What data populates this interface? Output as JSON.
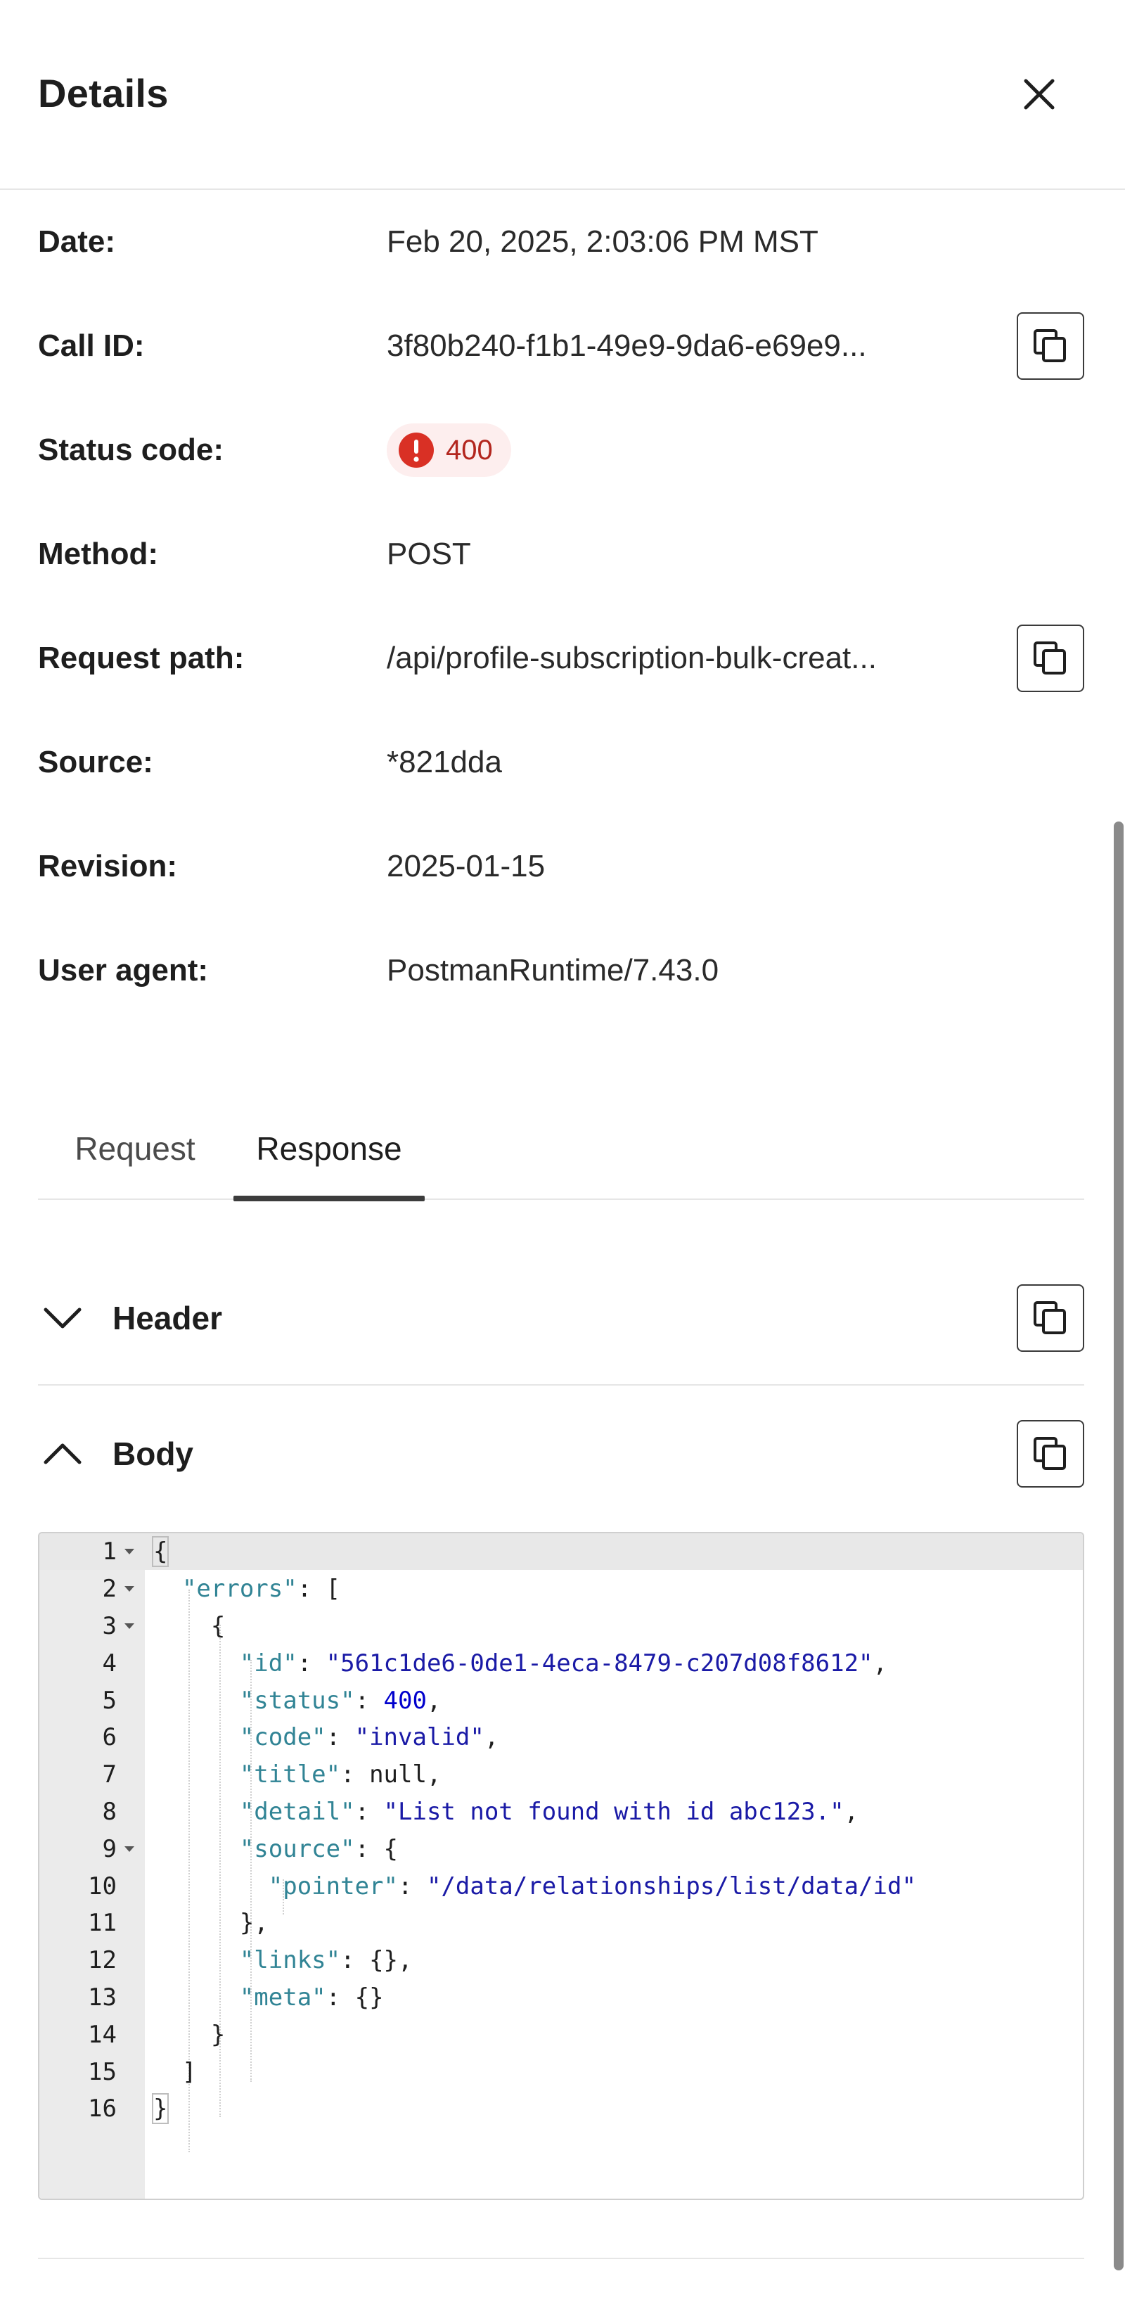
{
  "panel": {
    "title": "Details"
  },
  "details": [
    {
      "label": "Date:",
      "value": "Feb 20, 2025, 2:03:06 PM MST",
      "copyable": false
    },
    {
      "label": "Call ID:",
      "value": "3f80b240-f1b1-49e9-9da6-e69e9...",
      "copyable": true
    },
    {
      "label": "Status code:",
      "value": "400",
      "badge": true
    },
    {
      "label": "Method:",
      "value": "POST",
      "copyable": false
    },
    {
      "label": "Request path:",
      "value": "/api/profile-subscription-bulk-creat...",
      "copyable": true
    },
    {
      "label": "Source:",
      "value": "*821dda",
      "copyable": false
    },
    {
      "label": "Revision:",
      "value": "2025-01-15",
      "copyable": false
    },
    {
      "label": "User agent:",
      "value": "PostmanRuntime/7.43.0",
      "copyable": false
    }
  ],
  "tabs": [
    {
      "label": "Request",
      "active": false
    },
    {
      "label": "Response",
      "active": true
    }
  ],
  "sections": {
    "header": {
      "label": "Header",
      "expanded": false
    },
    "body": {
      "label": "Body",
      "expanded": true
    }
  },
  "code_lines": [
    {
      "n": "1",
      "fold": true,
      "text": "{"
    },
    {
      "n": "2",
      "fold": true,
      "text": "  \"errors\": ["
    },
    {
      "n": "3",
      "fold": true,
      "text": "    {"
    },
    {
      "n": "4",
      "fold": false,
      "text": "      \"id\": \"561c1de6-0de1-4eca-8479-c207d08f8612\","
    },
    {
      "n": "5",
      "fold": false,
      "text": "      \"status\": 400,"
    },
    {
      "n": "6",
      "fold": false,
      "text": "      \"code\": \"invalid\","
    },
    {
      "n": "7",
      "fold": false,
      "text": "      \"title\": null,"
    },
    {
      "n": "8",
      "fold": false,
      "text": "      \"detail\": \"List not found with id abc123.\","
    },
    {
      "n": "9",
      "fold": true,
      "text": "      \"source\": {"
    },
    {
      "n": "10",
      "fold": false,
      "text": "        \"pointer\": \"/data/relationships/list/data/id\""
    },
    {
      "n": "11",
      "fold": false,
      "text": "      },"
    },
    {
      "n": "12",
      "fold": false,
      "text": "      \"links\": {},"
    },
    {
      "n": "13",
      "fold": false,
      "text": "      \"meta\": {}"
    },
    {
      "n": "14",
      "fold": false,
      "text": "    }"
    },
    {
      "n": "15",
      "fold": false,
      "text": "  ]"
    },
    {
      "n": "16",
      "fold": false,
      "text": "}"
    }
  ],
  "colors": {
    "error_badge_bg": "#fdeeee",
    "error_red": "#d93025",
    "json_key": "#318495",
    "json_string": "#1a1aa6",
    "json_number": "#0000cd"
  }
}
